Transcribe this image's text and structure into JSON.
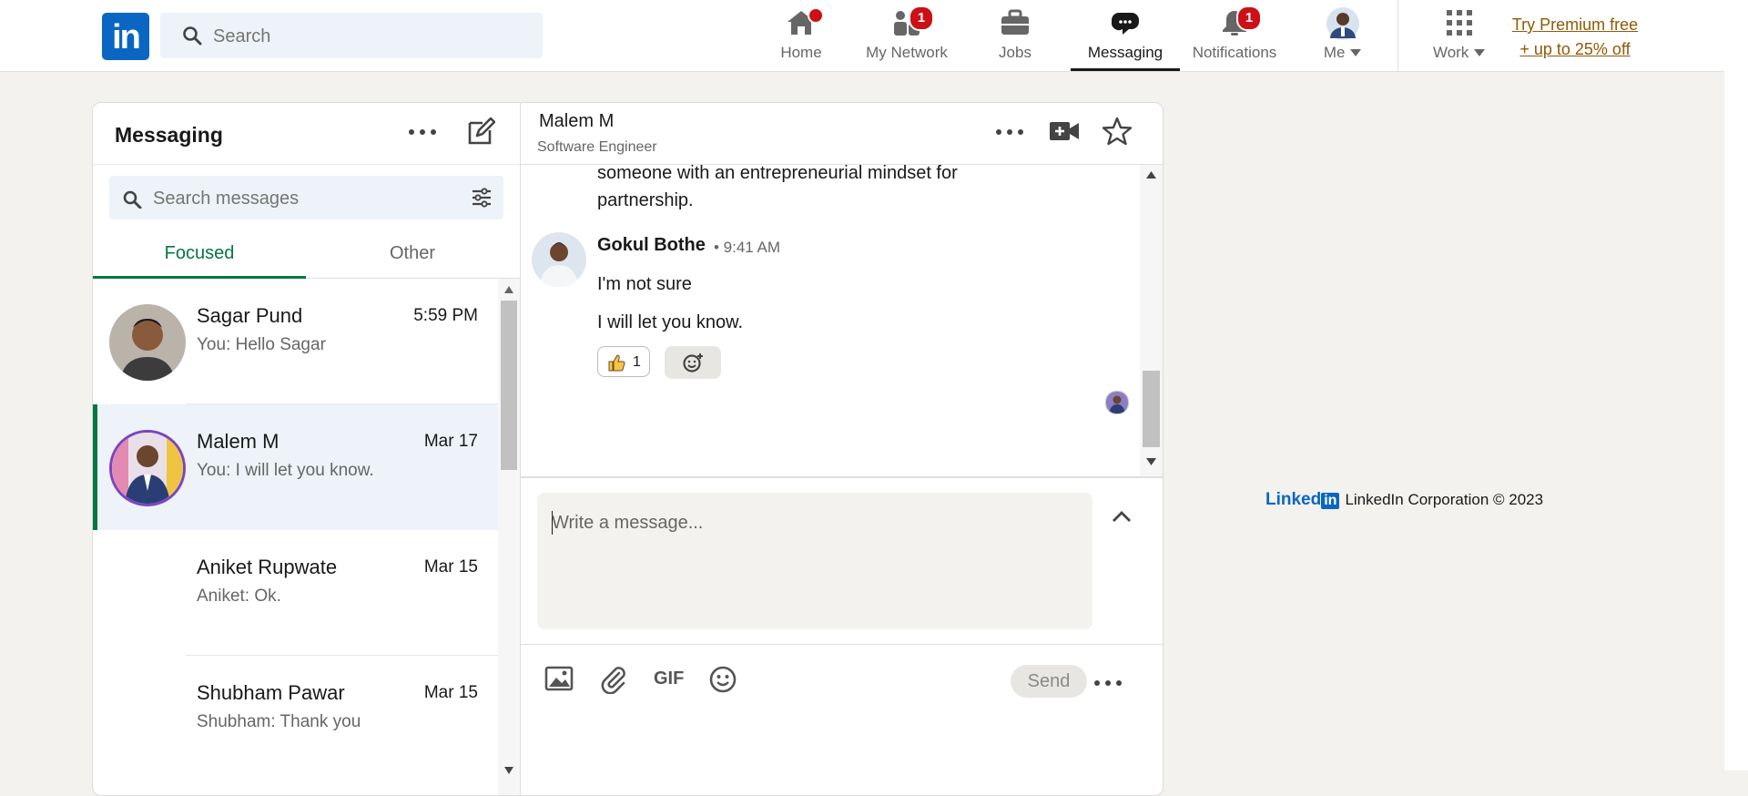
{
  "nav": {
    "logo": "in",
    "search_placeholder": "Search",
    "items": [
      {
        "label": "Home",
        "icon": "home-icon",
        "badge": ""
      },
      {
        "label": "My Network",
        "icon": "network-icon",
        "badge": "1"
      },
      {
        "label": "Jobs",
        "icon": "briefcase-icon",
        "badge": ""
      },
      {
        "label": "Messaging",
        "icon": "messaging-icon",
        "badge": ""
      },
      {
        "label": "Notifications",
        "icon": "bell-icon",
        "badge": "1"
      },
      {
        "label": "Me",
        "icon": "avatar",
        "badge": ""
      },
      {
        "label": "Work",
        "icon": "grid-icon",
        "badge": ""
      }
    ],
    "premium_line1": "Try Premium free",
    "premium_line2": "+ up to 25% off"
  },
  "messaging": {
    "title": "Messaging",
    "search_placeholder": "Search messages",
    "tabs": [
      {
        "label": "Focused",
        "active": true
      },
      {
        "label": "Other",
        "active": false
      }
    ],
    "conversations": [
      {
        "name": "Sagar Pund",
        "time": "5:59 PM",
        "preview": "You: Hello Sagar"
      },
      {
        "name": "Malem M",
        "time": "Mar 17",
        "preview": "You: I will let you know."
      },
      {
        "name": "Aniket Rupwate",
        "time": "Mar 15",
        "preview": "Aniket: Ok."
      },
      {
        "name": "Shubham Pawar",
        "time": "Mar 15",
        "preview": "Shubham: Thank you"
      }
    ]
  },
  "thread": {
    "contact_name": "Malem M",
    "contact_title": "Software Engineer",
    "prev_text_line1": "someone with an entrepreneurial mindset for",
    "prev_text_line2": "partnership.",
    "sender": "Gokul Bothe",
    "sender_time": "• 9:41 AM",
    "messages": [
      "I'm not sure",
      "I will let you know."
    ],
    "reaction_count": "1",
    "compose_placeholder": "Write a message...",
    "gif_label": "GIF",
    "send_label": "Send"
  },
  "footer": {
    "brand": "Linked",
    "brand_in": "in",
    "text": "LinkedIn Corporation © 2023"
  },
  "colors": {
    "brand_blue": "#0a66c2",
    "focused_green": "#057642",
    "badge_red": "#cc1016",
    "premium_gold": "#915907"
  }
}
